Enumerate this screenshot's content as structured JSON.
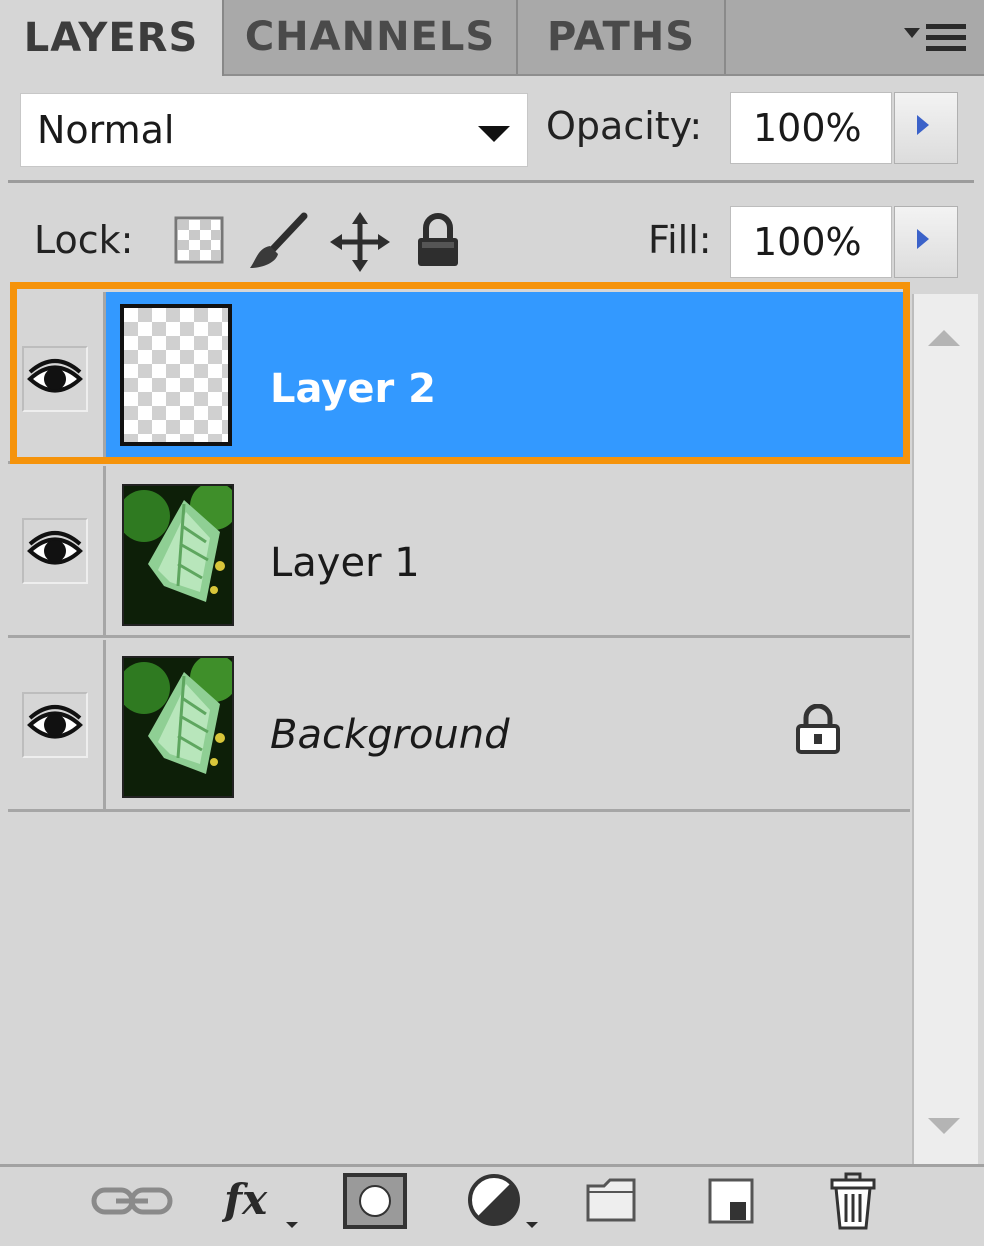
{
  "tabs": [
    {
      "label": "LAYERS",
      "active": true
    },
    {
      "label": "CHANNELS",
      "active": false
    },
    {
      "label": "PATHS",
      "active": false
    }
  ],
  "blend_mode": {
    "value": "Normal"
  },
  "opacity": {
    "label": "Opacity:",
    "value": "100%"
  },
  "lock": {
    "label": "Lock:",
    "icons": [
      "lock-transparent-pixels-icon",
      "lock-image-pixels-icon",
      "lock-position-icon",
      "lock-all-icon"
    ]
  },
  "fill": {
    "label": "Fill:",
    "value": "100%"
  },
  "layers": [
    {
      "name": "Layer 2",
      "visible": true,
      "selected": true,
      "thumbnail": "transparent",
      "locked": false
    },
    {
      "name": "Layer 1",
      "visible": true,
      "selected": false,
      "thumbnail": "leaf",
      "locked": false
    },
    {
      "name": "Background",
      "visible": true,
      "selected": false,
      "thumbnail": "leaf",
      "locked": true,
      "italic": true
    }
  ],
  "bottom_tools": [
    "link-layers-icon",
    "layer-style-fx-icon",
    "layer-mask-icon",
    "adjustment-layer-icon",
    "new-group-folder-icon",
    "new-layer-icon",
    "delete-layer-trash-icon"
  ],
  "colors": {
    "selection": "#3399ff",
    "highlight_outline": "#f5930b",
    "panel_bg": "#d6d6d6"
  }
}
